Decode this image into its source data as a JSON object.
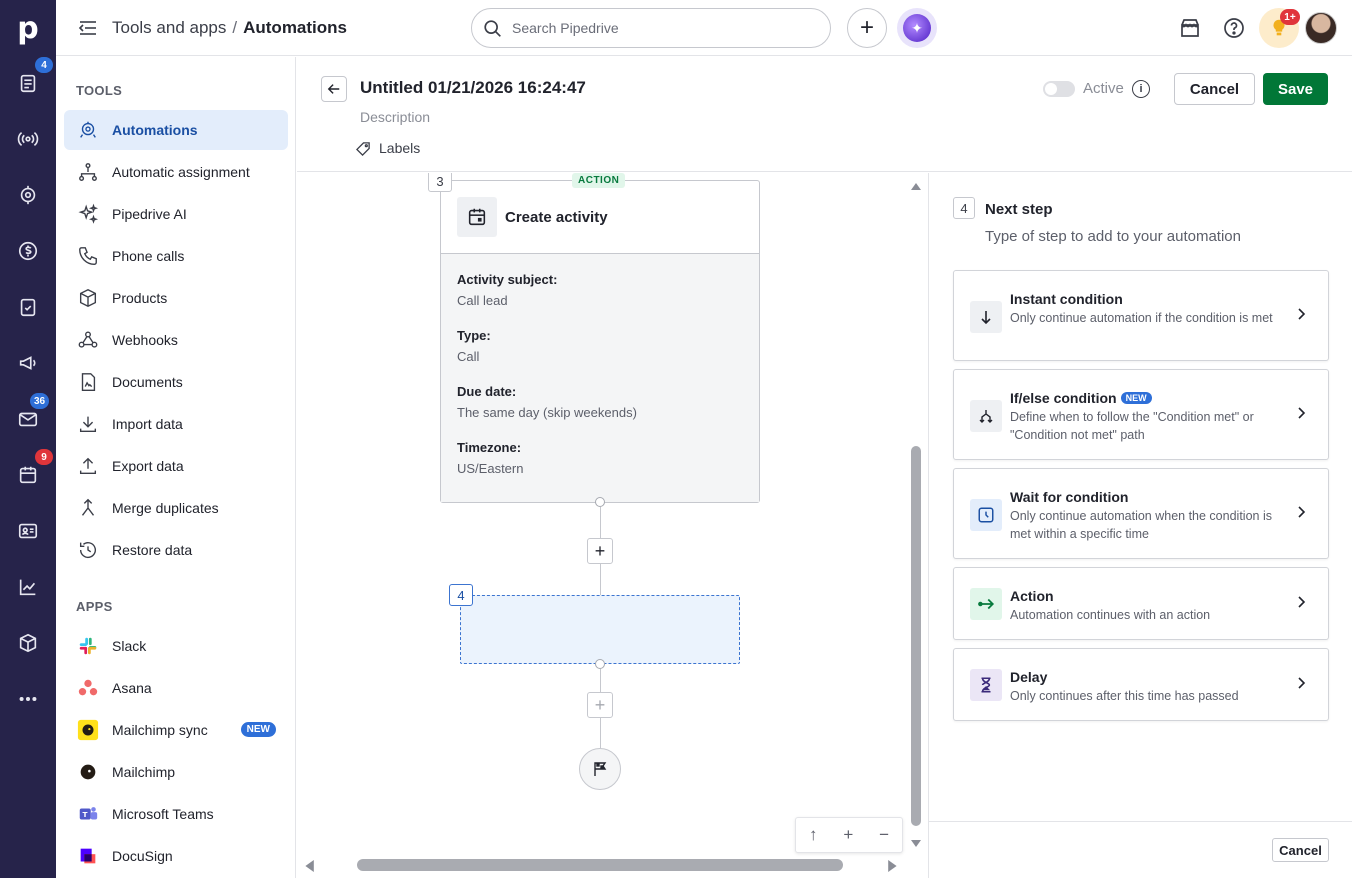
{
  "topbar": {
    "breadcrumb_parent": "Tools and apps",
    "breadcrumb_sep": "/",
    "breadcrumb_current": "Automations",
    "search_placeholder": "Search Pipedrive",
    "notifications_badge": "1+"
  },
  "rail": {
    "logo": "p",
    "badges": {
      "leads": "4",
      "mail": "36",
      "calendar": "9"
    }
  },
  "sidebar": {
    "tools_title": "TOOLS",
    "tools": [
      {
        "label": "Automations",
        "icon": "automations-icon"
      },
      {
        "label": "Automatic assignment",
        "icon": "assignment-icon"
      },
      {
        "label": "Pipedrive AI",
        "icon": "sparkle-icon"
      },
      {
        "label": "Phone calls",
        "icon": "phone-icon"
      },
      {
        "label": "Products",
        "icon": "box-icon"
      },
      {
        "label": "Webhooks",
        "icon": "webhook-icon"
      },
      {
        "label": "Documents",
        "icon": "document-icon"
      },
      {
        "label": "Import data",
        "icon": "import-icon"
      },
      {
        "label": "Export data",
        "icon": "export-icon"
      },
      {
        "label": "Merge duplicates",
        "icon": "merge-icon"
      },
      {
        "label": "Restore data",
        "icon": "restore-icon"
      }
    ],
    "apps_title": "APPS",
    "apps": [
      {
        "label": "Slack"
      },
      {
        "label": "Asana"
      },
      {
        "label": "Mailchimp sync",
        "badge": "NEW"
      },
      {
        "label": "Mailchimp"
      },
      {
        "label": "Microsoft Teams"
      },
      {
        "label": "DocuSign"
      }
    ]
  },
  "editor": {
    "title": "Untitled 01/21/2026 16:24:47",
    "description_placeholder": "Description",
    "labels": "Labels",
    "active_label": "Active",
    "cancel": "Cancel",
    "save": "Save"
  },
  "canvas": {
    "step3_number": "3",
    "step3_tag": "ACTION",
    "step3_title": "Create activity",
    "fields": [
      {
        "label": "Activity subject:",
        "value": "Call lead"
      },
      {
        "label": "Type:",
        "value": "Call"
      },
      {
        "label": "Due date:",
        "value": "The same day (skip weekends)"
      },
      {
        "label": "Timezone:",
        "value": "US/Eastern"
      }
    ],
    "step4_number": "4"
  },
  "panel": {
    "step_number": "4",
    "title": "Next step",
    "subtitle": "Type of step to add to your automation",
    "options": [
      {
        "title": "Instant condition",
        "desc": "Only continue automation if the condition is met",
        "icon": "arrow-down-icon"
      },
      {
        "title": "If/else condition",
        "badge": "NEW",
        "desc": "Define when to follow the \"Condition met\" or \"Condition not met\" path",
        "icon": "branch-icon"
      },
      {
        "title": "Wait for condition",
        "desc": "Only continue automation when the condition is met within a specific time",
        "icon": "clock-icon"
      },
      {
        "title": "Action",
        "desc": "Automation continues with an action",
        "icon": "action-arrow-icon"
      },
      {
        "title": "Delay",
        "desc": "Only continues after this time has passed",
        "icon": "hourglass-icon"
      }
    ],
    "cancel": "Cancel"
  },
  "colors": {
    "rail_bg": "#26234a",
    "save_green": "#017737",
    "active_blue": "#1a4fa3",
    "badge_red": "#e0353b",
    "badge_blue": "#2e6fd8"
  }
}
